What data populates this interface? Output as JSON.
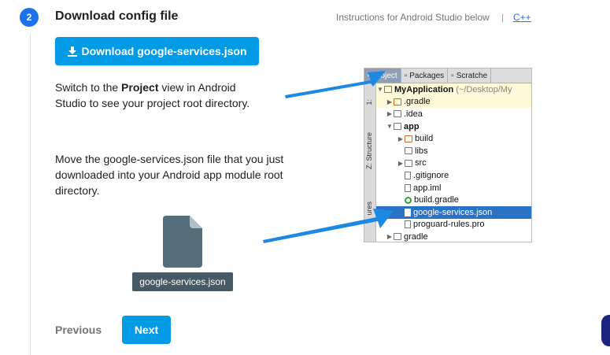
{
  "step": {
    "number": "2",
    "title": "Download config file",
    "instructions_link": "Instructions for Android Studio below",
    "separator": "|",
    "alt_link": "C++"
  },
  "download_button": {
    "label": "Download google-services.json",
    "icon": "download-icon"
  },
  "paragraph1": {
    "prefix": "Switch to the ",
    "bold": "Project",
    "suffix": " view in Android Studio to see your project root directory."
  },
  "paragraph2": "Move the google-services.json file that you just downloaded into your Android app module root directory.",
  "file_graphic": {
    "label": "google-services.json",
    "icon": "file-icon"
  },
  "nav": {
    "previous": "Previous",
    "next": "Next"
  },
  "studio_panel": {
    "tabs": [
      "Project",
      "Packages",
      "Scratche"
    ],
    "side_tabs": [
      "1:",
      "Z: Structure",
      "ures"
    ],
    "root": {
      "name": "MyApplication",
      "path": "(~/Desktop/My"
    },
    "items": [
      ".gradle",
      ".idea",
      "app",
      "build",
      "libs",
      "src",
      ".gitignore",
      "app.iml",
      "build.gradle",
      "google-services.json",
      "proguard-rules.pro",
      "gradle"
    ]
  },
  "colors": {
    "accent": "#039be5",
    "step_badge": "#1a73e8",
    "arrow": "#1e88e5",
    "file_label_bg": "#455a64",
    "highlight_row": "#2a72c6"
  }
}
